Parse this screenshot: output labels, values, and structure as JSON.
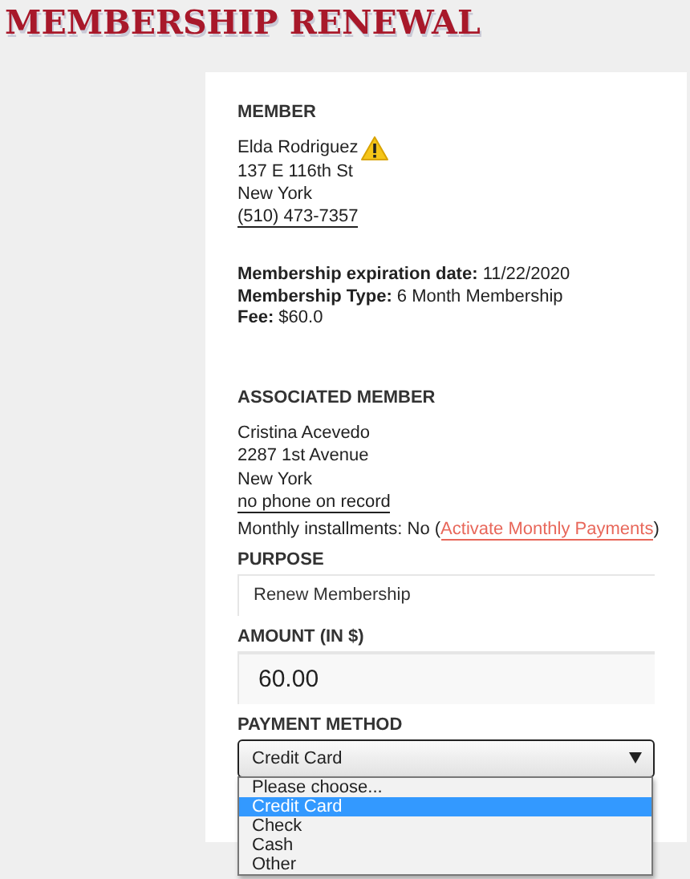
{
  "title": "MEMBERSHIP RENEWAL",
  "member": {
    "heading": "MEMBER",
    "name": "Elda Rodriguez",
    "warning": true,
    "address": "137 E 116th St",
    "city": "New York",
    "phone": "(510) 473-7357"
  },
  "membership_details": [
    "**Membership expiration date:** 11/22/2020",
    "**Membership Type:** 6 Month Membership",
    "**Fee:** $60.0"
  ],
  "associated_member": {
    "heading": "ASSOCIATED MEMBER",
    "name": "Cristina Acevedo",
    "warning": false,
    "address": "2287 1st Avenue",
    "city": "New York",
    "phone": "no phone on record"
  },
  "installments": {
    "text": "Monthly installments: No (",
    "link": "Activate Monthly Payments",
    "suffix": ")"
  },
  "purpose": {
    "label": "PURPOSE",
    "value": "Renew Membership"
  },
  "amount": {
    "label": "AMOUNT (IN $)",
    "value": "60.00"
  },
  "payment_method": {
    "label": "PAYMENT METHOD",
    "value": "Credit Card",
    "expanded": true,
    "options": [
      {
        "label": "Please choose...",
        "selected": false
      },
      {
        "label": "Credit Card",
        "selected": true
      },
      {
        "label": "Check",
        "selected": false
      },
      {
        "label": "Cash",
        "selected": false
      },
      {
        "label": "Other",
        "selected": false
      }
    ]
  }
}
